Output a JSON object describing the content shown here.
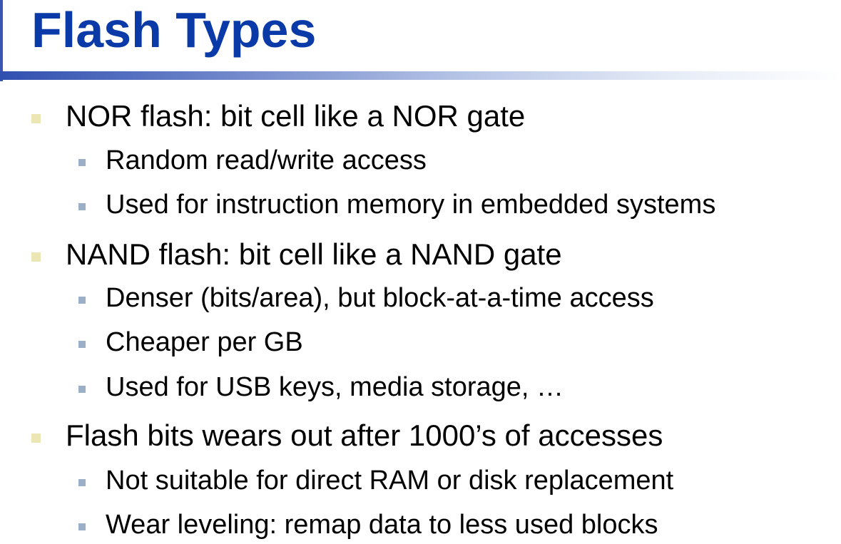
{
  "slide": {
    "title": "Flash Types",
    "bullets": [
      {
        "text": "NOR flash: bit cell like a NOR gate",
        "sub": [
          "Random read/write access",
          "Used for instruction memory in embedded systems"
        ]
      },
      {
        "text": "NAND flash: bit cell like a NAND gate",
        "sub": [
          "Denser (bits/area), but block-at-a-time access",
          "Cheaper per GB",
          "Used for USB keys, media storage, …"
        ]
      },
      {
        "text": "Flash bits wears out after 1000’s of accesses",
        "sub": [
          "Not suitable for direct RAM or disk replacement",
          "Wear leveling: remap data to less used blocks"
        ]
      }
    ]
  },
  "colors": {
    "title": "#0a3aa8",
    "level1_bullet": "#ece6b4",
    "level2_bullet": "#9ab0c8"
  }
}
